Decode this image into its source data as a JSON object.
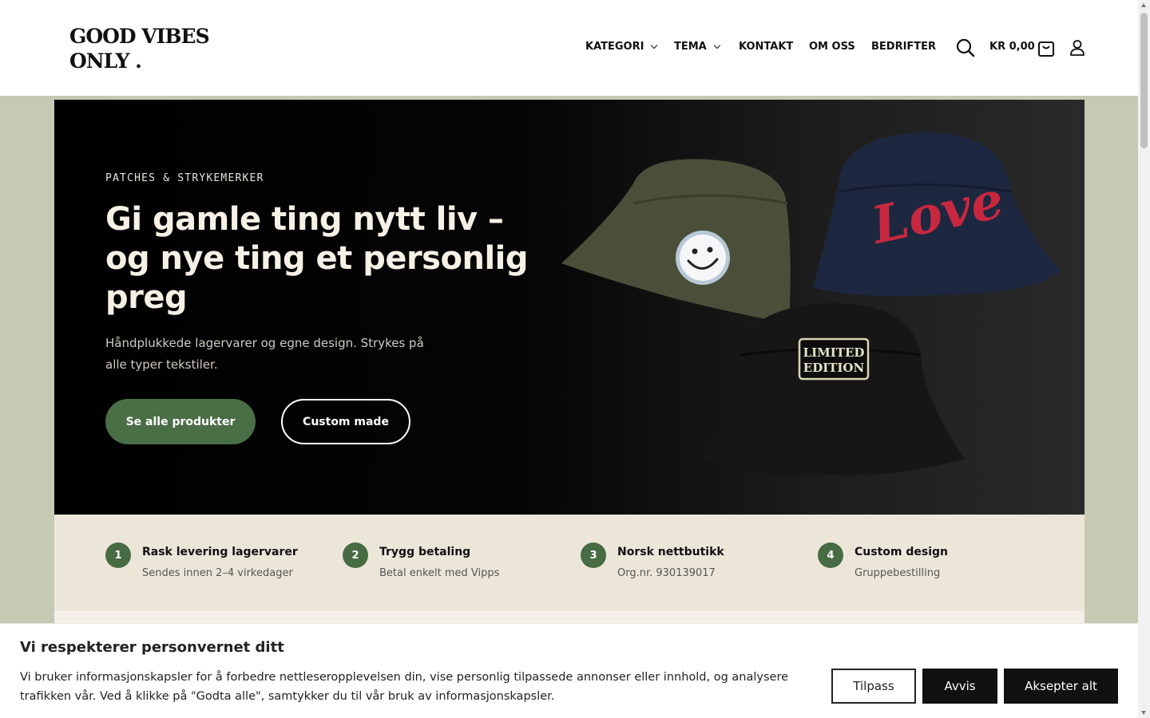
{
  "header": {
    "logo_line1": "GOOD VIBES",
    "logo_line2": "ONLY .",
    "nav": [
      "KATEGORI",
      "TEMA",
      "KONTAKT",
      "OM OSS",
      "BEDRIFTER"
    ],
    "cart_label": "KR 0,00"
  },
  "hero": {
    "eyebrow": "PATCHES & STRYKEMERKER",
    "title": "Gi gamle ting nytt liv – og nye ting et personlig preg",
    "subtitle": "Håndplukkede lagervarer og egne design. Strykes på alle typer tekstiler.",
    "primary_button": "Se alle produkter",
    "secondary_button": "Custom made",
    "art": {
      "patch_love": "Love",
      "patch_limited_line1": "LIMITED",
      "patch_limited_line2": "EDITION"
    }
  },
  "features": [
    {
      "num": "1",
      "title": "Rask levering lagervarer",
      "subtitle": "Sendes innen 2–4 virkedager"
    },
    {
      "num": "2",
      "title": "Trygg betaling",
      "subtitle": "Betal enkelt med Vipps"
    },
    {
      "num": "3",
      "title": "Norsk nettbutikk",
      "subtitle": "Org.nr. 930139017"
    },
    {
      "num": "4",
      "title": "Custom design",
      "subtitle": "Gruppebestilling"
    }
  ],
  "cookie": {
    "title": "Vi respekterer personvernet ditt",
    "text": "Vi bruker informasjonskapsler for å forbedre nettleseropplevelsen din, vise personlig tilpassede annonser eller innhold, og analysere trafikken vår. Ved å klikke på \"Godta alle\", samtykker du til vår bruk av informasjonskapsler.",
    "btn_customize": "Tilpass",
    "btn_reject": "Avvis",
    "btn_accept": "Aksepter alt"
  },
  "colors": {
    "accent_green": "#4a6e45",
    "page_bg": "#c6c9b4",
    "feature_bg": "#ece6d9"
  },
  "icons": [
    "chevron-down-icon",
    "search-icon",
    "cart-icon",
    "user-icon"
  ]
}
